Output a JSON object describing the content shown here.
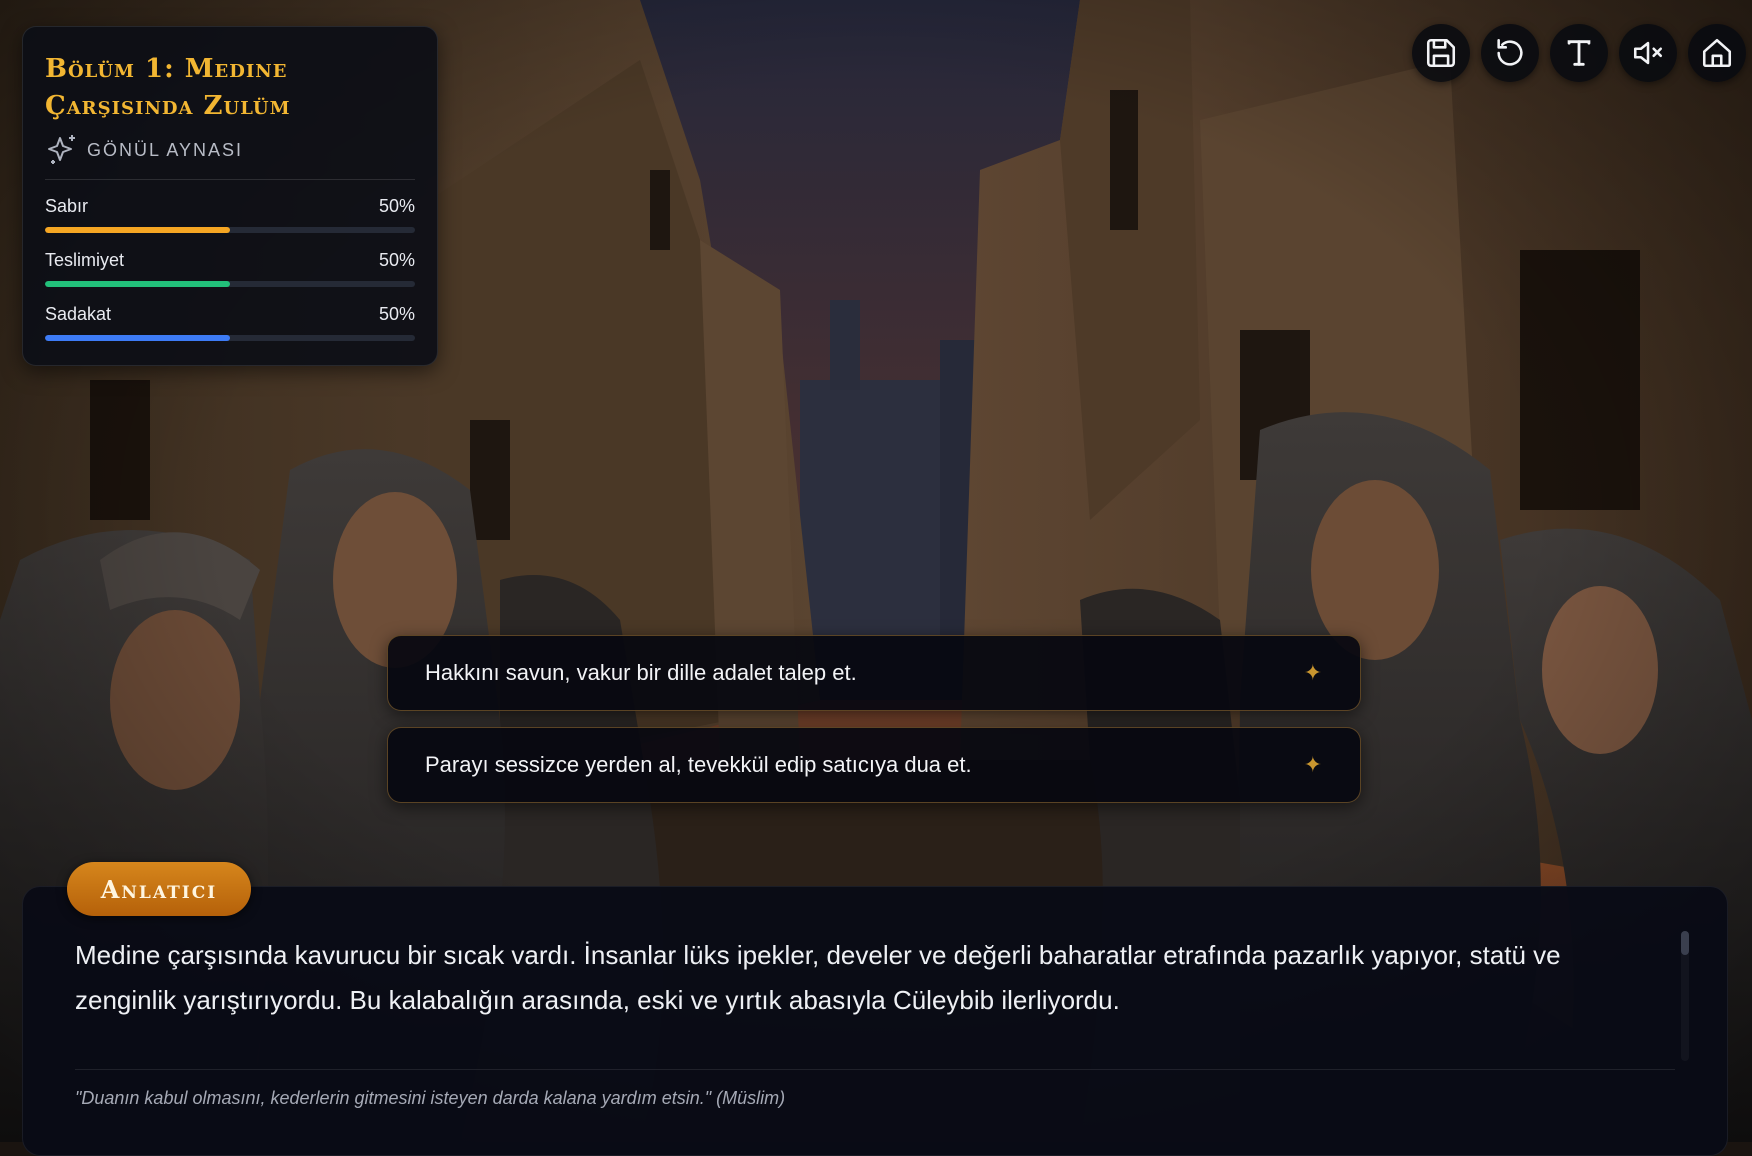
{
  "chapter": {
    "title": "Bölüm 1: Medine Çarşısında Zulüm",
    "panel_label": "GÖNÜL AYNASI",
    "panel_icon": "sparkles-icon"
  },
  "stats": [
    {
      "name": "Sabır",
      "value": 0.5,
      "value_text": "50%",
      "color": "#f5a623"
    },
    {
      "name": "Teslimiyet",
      "value": 0.5,
      "value_text": "50%",
      "color": "#22c07a"
    },
    {
      "name": "Sadakat",
      "value": 0.5,
      "value_text": "50%",
      "color": "#3d7bf5"
    }
  ],
  "toolbar": [
    {
      "icon": "save-icon"
    },
    {
      "icon": "restart-icon"
    },
    {
      "icon": "text-size-icon"
    },
    {
      "icon": "mute-icon"
    },
    {
      "icon": "home-icon"
    }
  ],
  "choices": [
    {
      "text": "Hakkını savun, vakur bir dille adalet talep et.",
      "marker": "✦"
    },
    {
      "text": "Parayı sessizce yerden al, tevekkül edip satıcıya dua et.",
      "marker": "✦"
    }
  ],
  "narration": {
    "speaker": "Anlatıcı",
    "text": "Medine çarşısında kavurucu bir sıcak vardı. İnsanlar lüks ipekler, develer ve değerli baharatlar etrafında pazarlık yapıyor, statü ve zenginlik yarıştırıyordu. Bu kalabalığın arasında, eski ve yırtık abasıyla Cüleybib ilerliyordu.",
    "quote": "\"Duanın kabul olmasını, kederlerin gitmesini isteyen darda kalana yardım etsin.\" (Müslim)"
  },
  "colors": {
    "accent_gold": "#f2b632",
    "badge_orange": "#c8730f",
    "choice_star": "#c9962f"
  }
}
